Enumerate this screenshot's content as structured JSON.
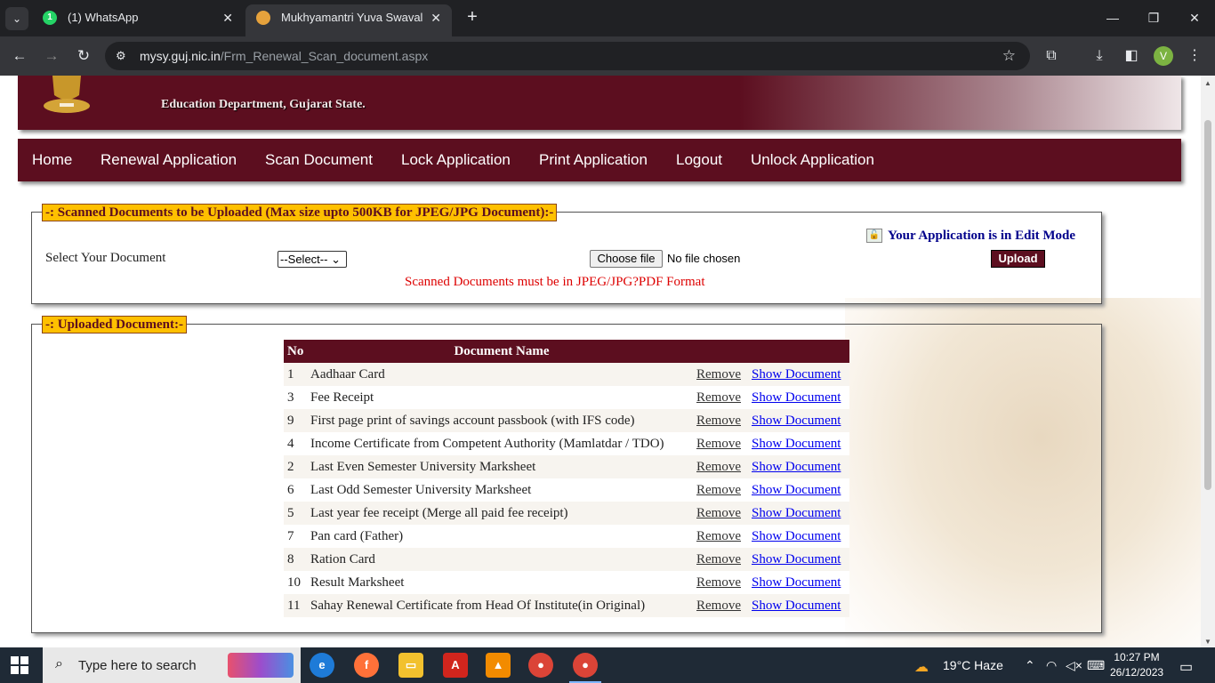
{
  "browser": {
    "tabs": [
      {
        "title": "(1) WhatsApp",
        "icon": "whatsapp-icon"
      },
      {
        "title": "Mukhyamantri Yuva Swavalamb",
        "icon": "site-favicon-icon"
      }
    ],
    "url_host": "mysy.guj.nic.in",
    "url_path": "/Frm_Renewal_Scan_document.aspx",
    "profile_initial": "V"
  },
  "header": {
    "subtitle": "Education Department, Gujarat State."
  },
  "menu": [
    "Home",
    "Renewal Application",
    "Scan Document",
    "Lock Application",
    "Print Application",
    "Logout",
    "Unlock Application"
  ],
  "scan_section": {
    "legend": "-: Scanned Documents to be Uploaded (Max size upto 500KB for JPEG/JPG Document):-",
    "select_label": "Select Your Document",
    "select_value": "--Select--",
    "file_button": "Choose file",
    "file_status": "No file chosen",
    "edit_mode": "Your Application is in Edit Mode",
    "upload_button": "Upload",
    "format_note": "Scanned Documents must be in  JPEG/JPG?PDF Format"
  },
  "uploaded_section": {
    "legend": "-: Uploaded Document:-",
    "columns": [
      "No",
      "Document Name"
    ],
    "remove_label": "Remove",
    "show_label": "Show Document",
    "rows": [
      {
        "no": "1",
        "name": "Aadhaar Card"
      },
      {
        "no": "3",
        "name": "Fee Receipt"
      },
      {
        "no": "9",
        "name": "First page print of savings account passbook (with IFS code)"
      },
      {
        "no": "4",
        "name": "Income Certificate from Competent Authority (Mamlatdar / TDO)"
      },
      {
        "no": "2",
        "name": "Last Even Semester University Marksheet"
      },
      {
        "no": "6",
        "name": "Last Odd Semester University Marksheet"
      },
      {
        "no": "5",
        "name": "Last year fee receipt (Merge all paid fee receipt)"
      },
      {
        "no": "7",
        "name": "Pan card (Father)"
      },
      {
        "no": "8",
        "name": "Ration Card"
      },
      {
        "no": "10",
        "name": "Result Marksheet"
      },
      {
        "no": "11",
        "name": "Sahay Renewal Certificate from Head Of Institute(in Original)"
      }
    ]
  },
  "taskbar": {
    "search_placeholder": "Type here to search",
    "weather": "19°C  Haze",
    "time": "10:27 PM",
    "date": "26/12/2023"
  },
  "colors": {
    "brand_maroon": "#5c0e1f",
    "legend_yellow": "#ffc000"
  }
}
